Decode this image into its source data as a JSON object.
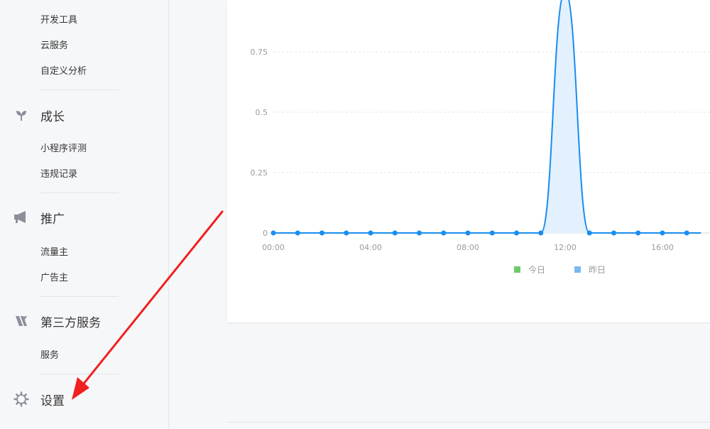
{
  "sidebar": {
    "group_dev": {
      "items": [
        {
          "label": "开发工具"
        },
        {
          "label": "云服务"
        },
        {
          "label": "自定义分析"
        }
      ]
    },
    "group_growth": {
      "title": "成长",
      "icon": "sprout-icon",
      "items": [
        {
          "label": "小程序评测"
        },
        {
          "label": "违规记录"
        }
      ]
    },
    "group_promotion": {
      "title": "推广",
      "icon": "megaphone-icon",
      "items": [
        {
          "label": "流量主"
        },
        {
          "label": "广告主"
        }
      ]
    },
    "group_third_party": {
      "title": "第三方服务",
      "icon": "third-party-icon",
      "items": [
        {
          "label": "服务"
        }
      ]
    },
    "group_settings": {
      "title": "设置",
      "icon": "gear-icon"
    }
  },
  "chart_data": {
    "type": "area",
    "x_ticks": [
      "00:00",
      "04:00",
      "08:00",
      "12:00",
      "16:00"
    ],
    "y_ticks": [
      "0",
      "0.25",
      "0.5",
      "0.75"
    ],
    "ylim": [
      0,
      1
    ],
    "x_hours": [
      0,
      1,
      2,
      3,
      4,
      5,
      6,
      7,
      8,
      9,
      10,
      11,
      12,
      13,
      14,
      15,
      16,
      17
    ],
    "series": [
      {
        "name": "今日",
        "color": "#6cc96c",
        "values": []
      },
      {
        "name": "昨日",
        "color": "#1a8cf0",
        "fill": "#e3f0fd",
        "values": [
          0,
          0,
          0,
          0,
          0,
          0,
          0,
          0,
          0,
          0,
          0,
          0,
          1,
          0,
          0,
          0,
          0,
          0
        ]
      }
    ],
    "legend_position": "bottom-center",
    "grid": true
  },
  "annotation": {
    "arrow_color": "#f02020"
  }
}
